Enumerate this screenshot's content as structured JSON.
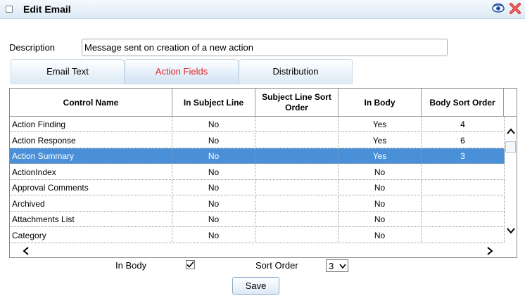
{
  "window": {
    "title": "Edit Email"
  },
  "description": {
    "label": "Description",
    "value": "Message sent on creation of a new action"
  },
  "tabs": [
    {
      "label": "Email Text",
      "active": false
    },
    {
      "label": "Action Fields",
      "active": true
    },
    {
      "label": "Distribution",
      "active": false
    }
  ],
  "grid": {
    "columns": [
      "Control Name",
      "In Subject Line",
      "Subject Line Sort Order",
      "In Body",
      "Body Sort Order"
    ],
    "rows": [
      {
        "name": "Action Finding",
        "in_subject": "No",
        "subject_sort": "",
        "in_body": "Yes",
        "body_sort": "4"
      },
      {
        "name": "Action Response",
        "in_subject": "No",
        "subject_sort": "",
        "in_body": "Yes",
        "body_sort": "6"
      },
      {
        "name": "Action Summary",
        "in_subject": "No",
        "subject_sort": "",
        "in_body": "Yes",
        "body_sort": "3"
      },
      {
        "name": "ActionIndex",
        "in_subject": "No",
        "subject_sort": "",
        "in_body": "No",
        "body_sort": ""
      },
      {
        "name": "Approval Comments",
        "in_subject": "No",
        "subject_sort": "",
        "in_body": "No",
        "body_sort": ""
      },
      {
        "name": "Archived",
        "in_subject": "No",
        "subject_sort": "",
        "in_body": "No",
        "body_sort": ""
      },
      {
        "name": "Attachments List",
        "in_subject": "No",
        "subject_sort": "",
        "in_body": "No",
        "body_sort": ""
      },
      {
        "name": "Category",
        "in_subject": "No",
        "subject_sort": "",
        "in_body": "No",
        "body_sort": ""
      }
    ],
    "selected_row": 2
  },
  "footer": {
    "in_body_label": "In Body",
    "in_body_checked": true,
    "sort_order_label": "Sort Order",
    "sort_order_value": "3",
    "save_label": "Save"
  },
  "colors": {
    "selected_row": "#4a90d9",
    "active_tab_text": "#e0272b",
    "close_icon": "#d9302c"
  },
  "icons": {
    "view": "eye-icon",
    "close": "close-icon",
    "window": "window-icon"
  }
}
